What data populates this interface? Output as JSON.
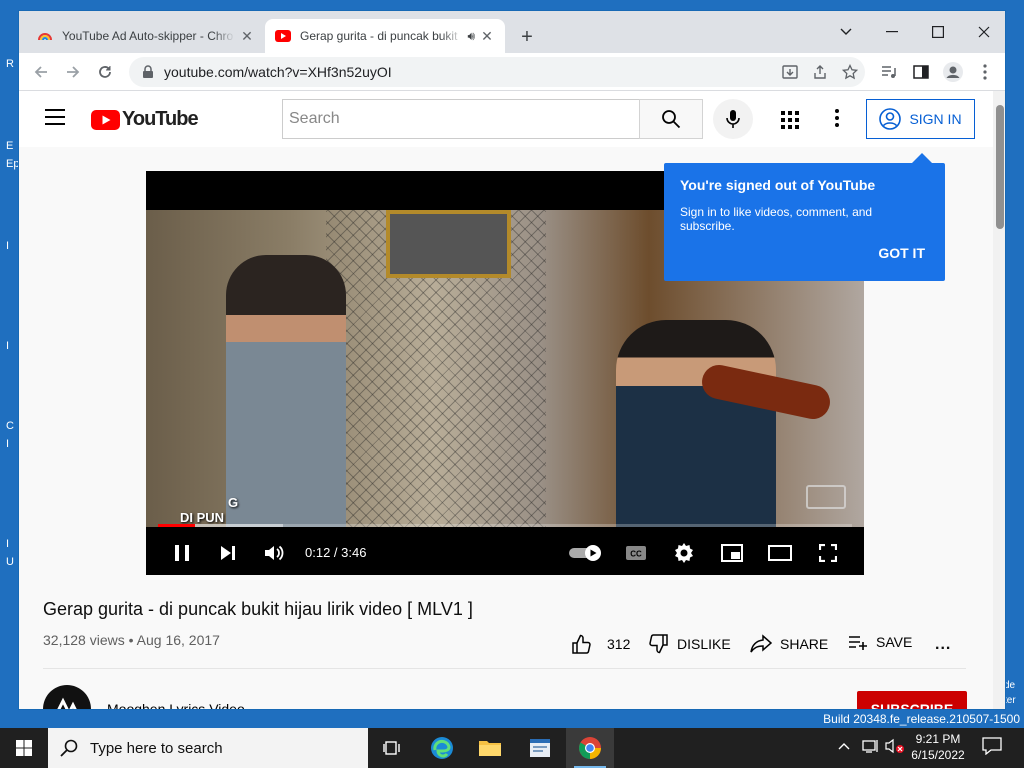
{
  "desktop": {
    "left_fragments": [
      "R",
      "E",
      "Ep",
      "I",
      "I",
      "I",
      "C",
      "I",
      "I",
      "I",
      "U"
    ],
    "right_fragments": [
      "de",
      "ter"
    ],
    "build_text": "Build 20348.fe_release.210507-1500"
  },
  "browser": {
    "tabs": [
      {
        "title": "YouTube Ad Auto-skipper - Chro",
        "icon": "rainbow-extension-icon",
        "active": false
      },
      {
        "title": "Gerap gurita - di puncak bukit",
        "icon": "youtube-favicon",
        "active": true,
        "audio": true
      }
    ],
    "new_tab": "+",
    "window_controls": {
      "minimize": "—",
      "maximize": "☐",
      "close": "✕",
      "tab_search": "⌄"
    },
    "url": "youtube.com/watch?v=XHf3n52uyOI"
  },
  "youtube": {
    "logo_text": "YouTube",
    "search_placeholder": "Search",
    "sign_in_label": "SIGN IN",
    "tooltip": {
      "title": "You're signed out of YouTube",
      "body": "Sign in to like videos, comment, and subscribe.",
      "action": "GOT IT"
    },
    "player": {
      "time": "0:12 / 3:46",
      "progress_fraction": 0.053,
      "buffered_fraction": 0.18,
      "overlay_text": "DI PUN",
      "overlay_text_top": "G"
    },
    "video": {
      "title": "Gerap gurita - di puncak bukit hijau lirik video [ MLV1 ]",
      "views": "32,128 views",
      "date": "Aug 16, 2017",
      "likes": "312",
      "dislike_label": "DISLIKE",
      "share_label": "SHARE",
      "save_label": "SAVE",
      "more_label": "..."
    },
    "channel": {
      "name": "Mooghen Lyrics Video",
      "subscribe_label": "SUBSCRIBE"
    }
  },
  "taskbar": {
    "search_placeholder": "Type here to search",
    "time": "9:21 PM",
    "date": "6/15/2022"
  },
  "colors": {
    "youtube_red": "#ff0000",
    "link_blue": "#065fd4",
    "tooltip_blue": "#1a73e8",
    "subscribe_red": "#cc0000",
    "desktop_blue": "#1f6fbf"
  }
}
